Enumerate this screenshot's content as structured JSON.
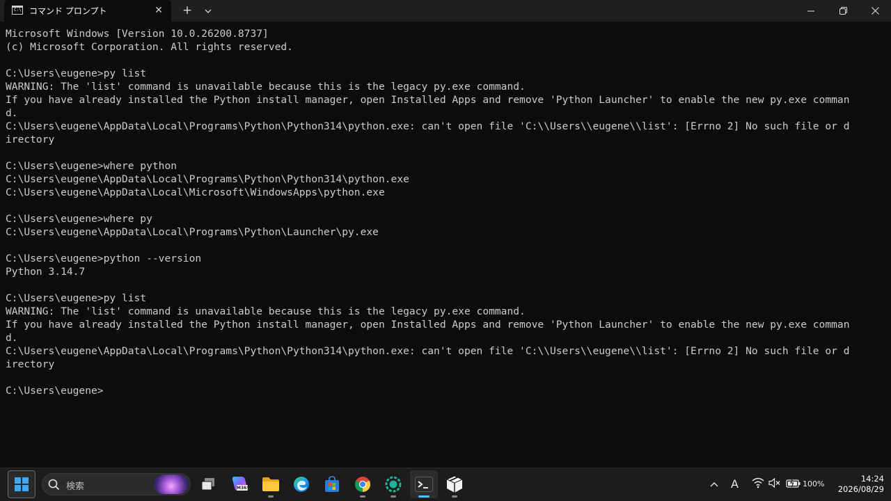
{
  "window": {
    "tab_title": "コマンド プロンプト",
    "tab_icon_text": "C:\\",
    "close_tab": "✕",
    "new_tab": "+",
    "dropdown": "⌄",
    "minimize": "─",
    "restore": "❐",
    "close": "✕"
  },
  "terminal": {
    "lines": [
      "Microsoft Windows [Version 10.0.26200.8737]",
      "(c) Microsoft Corporation. All rights reserved.",
      "",
      "C:\\Users\\eugene>py list",
      "WARNING: The 'list' command is unavailable because this is the legacy py.exe command.",
      "If you have already installed the Python install manager, open Installed Apps and remove 'Python Launcher' to enable the new py.exe comman",
      "d.",
      "C:\\Users\\eugene\\AppData\\Local\\Programs\\Python\\Python314\\python.exe: can't open file 'C:\\\\Users\\\\eugene\\\\list': [Errno 2] No such file or d",
      "irectory",
      "",
      "C:\\Users\\eugene>where python",
      "C:\\Users\\eugene\\AppData\\Local\\Programs\\Python\\Python314\\python.exe",
      "C:\\Users\\eugene\\AppData\\Local\\Microsoft\\WindowsApps\\python.exe",
      "",
      "C:\\Users\\eugene>where py",
      "C:\\Users\\eugene\\AppData\\Local\\Programs\\Python\\Launcher\\py.exe",
      "",
      "C:\\Users\\eugene>python --version",
      "Python 3.14.7",
      "",
      "C:\\Users\\eugene>py list",
      "WARNING: The 'list' command is unavailable because this is the legacy py.exe command.",
      "If you have already installed the Python install manager, open Installed Apps and remove 'Python Launcher' to enable the new py.exe comman",
      "d.",
      "C:\\Users\\eugene\\AppData\\Local\\Programs\\Python\\Python314\\python.exe: can't open file 'C:\\\\Users\\\\eugene\\\\list': [Errno 2] No such file or d",
      "irectory",
      "",
      "C:\\Users\\eugene>"
    ]
  },
  "taskbar": {
    "search_placeholder": "検索",
    "m365_label": "M365",
    "apps": [
      "start-icon",
      "task-view-icon",
      "copilot-m365-icon",
      "file-explorer-icon",
      "edge-icon",
      "store-icon",
      "chrome-icon",
      "app-green-icon",
      "terminal-icon",
      "package-icon"
    ],
    "tray": {
      "chevron": "^",
      "ime": "A",
      "battery": "100%"
    },
    "clock": {
      "time": "14:24",
      "date": "2026/08/29"
    }
  },
  "colors": {
    "terminal_bg": "#0c0c0c",
    "terminal_fg": "#cccccc",
    "titlebar_bg": "#1f1f1f",
    "taskbar_bg": "#1c1c1c",
    "accent": "#4cc2ff"
  }
}
